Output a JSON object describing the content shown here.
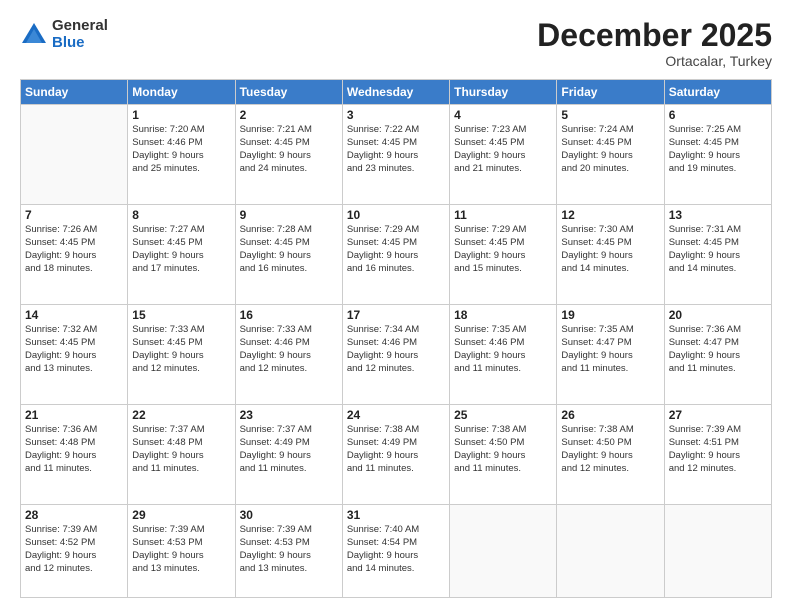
{
  "header": {
    "logo_general": "General",
    "logo_blue": "Blue",
    "month_title": "December 2025",
    "location": "Ortacalar, Turkey"
  },
  "days_of_week": [
    "Sunday",
    "Monday",
    "Tuesday",
    "Wednesday",
    "Thursday",
    "Friday",
    "Saturday"
  ],
  "weeks": [
    [
      {
        "day": "",
        "info": ""
      },
      {
        "day": "1",
        "info": "Sunrise: 7:20 AM\nSunset: 4:46 PM\nDaylight: 9 hours\nand 25 minutes."
      },
      {
        "day": "2",
        "info": "Sunrise: 7:21 AM\nSunset: 4:45 PM\nDaylight: 9 hours\nand 24 minutes."
      },
      {
        "day": "3",
        "info": "Sunrise: 7:22 AM\nSunset: 4:45 PM\nDaylight: 9 hours\nand 23 minutes."
      },
      {
        "day": "4",
        "info": "Sunrise: 7:23 AM\nSunset: 4:45 PM\nDaylight: 9 hours\nand 21 minutes."
      },
      {
        "day": "5",
        "info": "Sunrise: 7:24 AM\nSunset: 4:45 PM\nDaylight: 9 hours\nand 20 minutes."
      },
      {
        "day": "6",
        "info": "Sunrise: 7:25 AM\nSunset: 4:45 PM\nDaylight: 9 hours\nand 19 minutes."
      }
    ],
    [
      {
        "day": "7",
        "info": "Sunrise: 7:26 AM\nSunset: 4:45 PM\nDaylight: 9 hours\nand 18 minutes."
      },
      {
        "day": "8",
        "info": "Sunrise: 7:27 AM\nSunset: 4:45 PM\nDaylight: 9 hours\nand 17 minutes."
      },
      {
        "day": "9",
        "info": "Sunrise: 7:28 AM\nSunset: 4:45 PM\nDaylight: 9 hours\nand 16 minutes."
      },
      {
        "day": "10",
        "info": "Sunrise: 7:29 AM\nSunset: 4:45 PM\nDaylight: 9 hours\nand 16 minutes."
      },
      {
        "day": "11",
        "info": "Sunrise: 7:29 AM\nSunset: 4:45 PM\nDaylight: 9 hours\nand 15 minutes."
      },
      {
        "day": "12",
        "info": "Sunrise: 7:30 AM\nSunset: 4:45 PM\nDaylight: 9 hours\nand 14 minutes."
      },
      {
        "day": "13",
        "info": "Sunrise: 7:31 AM\nSunset: 4:45 PM\nDaylight: 9 hours\nand 14 minutes."
      }
    ],
    [
      {
        "day": "14",
        "info": "Sunrise: 7:32 AM\nSunset: 4:45 PM\nDaylight: 9 hours\nand 13 minutes."
      },
      {
        "day": "15",
        "info": "Sunrise: 7:33 AM\nSunset: 4:45 PM\nDaylight: 9 hours\nand 12 minutes."
      },
      {
        "day": "16",
        "info": "Sunrise: 7:33 AM\nSunset: 4:46 PM\nDaylight: 9 hours\nand 12 minutes."
      },
      {
        "day": "17",
        "info": "Sunrise: 7:34 AM\nSunset: 4:46 PM\nDaylight: 9 hours\nand 12 minutes."
      },
      {
        "day": "18",
        "info": "Sunrise: 7:35 AM\nSunset: 4:46 PM\nDaylight: 9 hours\nand 11 minutes."
      },
      {
        "day": "19",
        "info": "Sunrise: 7:35 AM\nSunset: 4:47 PM\nDaylight: 9 hours\nand 11 minutes."
      },
      {
        "day": "20",
        "info": "Sunrise: 7:36 AM\nSunset: 4:47 PM\nDaylight: 9 hours\nand 11 minutes."
      }
    ],
    [
      {
        "day": "21",
        "info": "Sunrise: 7:36 AM\nSunset: 4:48 PM\nDaylight: 9 hours\nand 11 minutes."
      },
      {
        "day": "22",
        "info": "Sunrise: 7:37 AM\nSunset: 4:48 PM\nDaylight: 9 hours\nand 11 minutes."
      },
      {
        "day": "23",
        "info": "Sunrise: 7:37 AM\nSunset: 4:49 PM\nDaylight: 9 hours\nand 11 minutes."
      },
      {
        "day": "24",
        "info": "Sunrise: 7:38 AM\nSunset: 4:49 PM\nDaylight: 9 hours\nand 11 minutes."
      },
      {
        "day": "25",
        "info": "Sunrise: 7:38 AM\nSunset: 4:50 PM\nDaylight: 9 hours\nand 11 minutes."
      },
      {
        "day": "26",
        "info": "Sunrise: 7:38 AM\nSunset: 4:50 PM\nDaylight: 9 hours\nand 12 minutes."
      },
      {
        "day": "27",
        "info": "Sunrise: 7:39 AM\nSunset: 4:51 PM\nDaylight: 9 hours\nand 12 minutes."
      }
    ],
    [
      {
        "day": "28",
        "info": "Sunrise: 7:39 AM\nSunset: 4:52 PM\nDaylight: 9 hours\nand 12 minutes."
      },
      {
        "day": "29",
        "info": "Sunrise: 7:39 AM\nSunset: 4:53 PM\nDaylight: 9 hours\nand 13 minutes."
      },
      {
        "day": "30",
        "info": "Sunrise: 7:39 AM\nSunset: 4:53 PM\nDaylight: 9 hours\nand 13 minutes."
      },
      {
        "day": "31",
        "info": "Sunrise: 7:40 AM\nSunset: 4:54 PM\nDaylight: 9 hours\nand 14 minutes."
      },
      {
        "day": "",
        "info": ""
      },
      {
        "day": "",
        "info": ""
      },
      {
        "day": "",
        "info": ""
      }
    ]
  ]
}
